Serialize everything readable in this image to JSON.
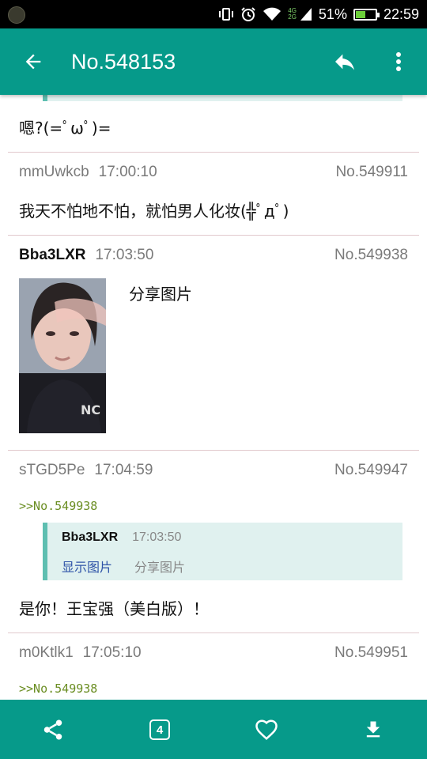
{
  "status_bar": {
    "network_top": "4G",
    "network_bottom": "2G",
    "battery_percent": "51%",
    "battery_level": 0.51,
    "time": "22:59"
  },
  "app_bar": {
    "title": "No.548153",
    "icons": [
      "back-arrow-icon",
      "reply-icon",
      "more-vert-icon"
    ]
  },
  "posts": [
    {
      "body": "嗯?(=ﾟωﾟ)="
    },
    {
      "user": "mmUwkcb",
      "time": "17:00:10",
      "no": "No.549911",
      "body": "我天不怕地不怕，就怕男人化妆(╬ﾟдﾟ)"
    },
    {
      "user": "Bba3LXR",
      "time": "17:03:50",
      "no": "No.549938",
      "body": "分享图片"
    },
    {
      "user": "sTGD5Pe",
      "time": "17:04:59",
      "no": "No.549947",
      "reply_to": ">>No.549938",
      "quote": {
        "user": "Bba3LXR",
        "time": "17:03:50",
        "show_image": "显示图片",
        "text": "分享图片"
      },
      "body": "是你！王宝强（美白版）！"
    },
    {
      "user": "m0Ktlk1",
      "time": "17:05:10",
      "no": "No.549951",
      "reply_to": ">>No.549938"
    }
  ],
  "bottom_bar": {
    "page_count": "4",
    "icons": [
      "share-icon",
      "page-count-icon",
      "heart-icon",
      "download-icon"
    ]
  },
  "colors": {
    "primary": "#069a8a",
    "quote_bg": "#e0f1ef",
    "quote_bar": "#5ebfb1",
    "reply_link": "#6b8e23",
    "show_image_link": "#2f54a8"
  }
}
